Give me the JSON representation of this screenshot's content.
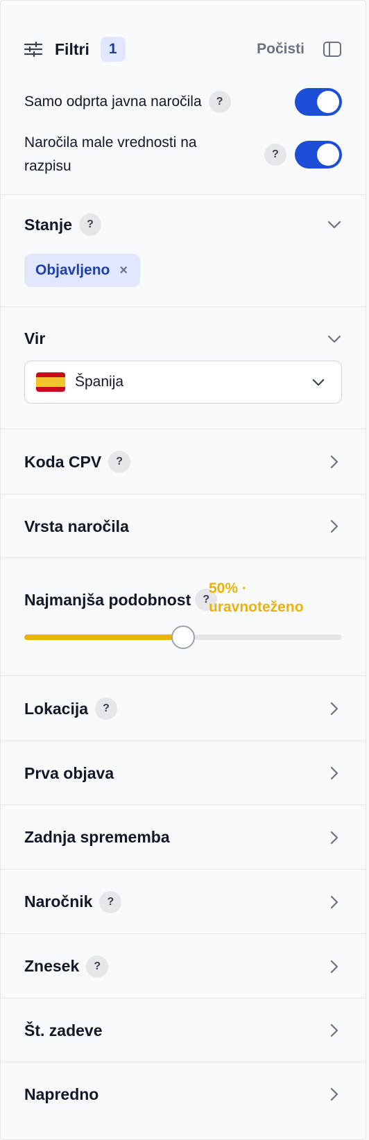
{
  "header": {
    "title": "Filtri",
    "active_count": "1",
    "clear_label": "Počisti",
    "filter_icon": "sliders-icon",
    "panel_icon": "sidebar-toggle-icon"
  },
  "toggles": [
    {
      "label": "Samo odprta javna naročila",
      "help": "?",
      "on": true
    },
    {
      "label": "Naročila male vrednosti na razpisu",
      "help": "?",
      "on": true
    }
  ],
  "sections": {
    "state": {
      "title": "Stanje",
      "help": "?",
      "chip": "Objavljeno",
      "chip_remove": "×"
    },
    "source": {
      "title": "Vir",
      "selected": "Španija"
    },
    "cpv": {
      "title": "Koda CPV",
      "help": "?"
    },
    "contract_type": {
      "title": "Vrsta naročila"
    },
    "similarity": {
      "title": "Najmanjša podobnost",
      "help": "?",
      "value_text": "50% · uravnoteženo",
      "value_percent": 50
    },
    "location": {
      "title": "Lokacija",
      "help": "?"
    },
    "first_publish": {
      "title": "Prva objava"
    },
    "last_change": {
      "title": "Zadnja sprememba"
    },
    "buyer": {
      "title": "Naročnik",
      "help": "?"
    },
    "amount": {
      "title": "Znesek",
      "help": "?"
    },
    "case_no": {
      "title": "Št. zadeve"
    },
    "advanced": {
      "title": "Napredno"
    }
  },
  "colors": {
    "accent": "#1d4ed8",
    "chip_bg": "#e0e7ff",
    "slider": "#eab308"
  }
}
